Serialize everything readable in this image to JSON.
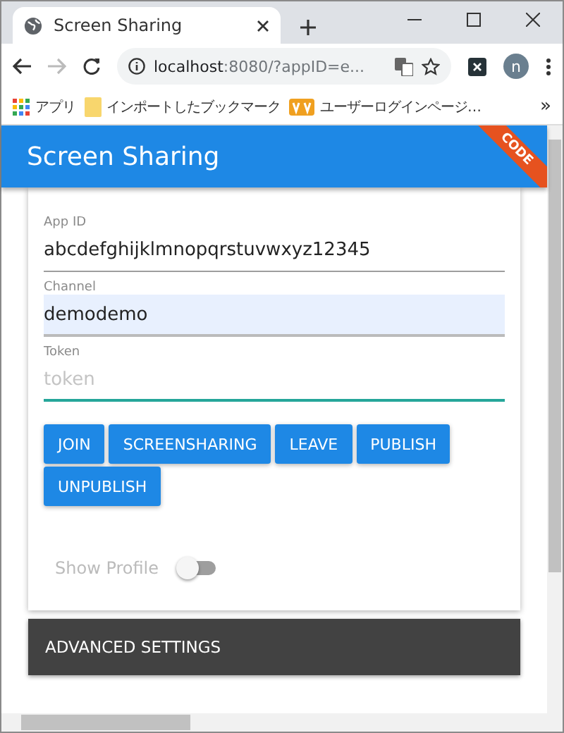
{
  "browser": {
    "tab": {
      "title": "Screen Sharing"
    },
    "address": {
      "host": "localhost",
      "rest": ":8080/?appID=e..."
    },
    "profile_initial": "n",
    "bookmarks": [
      {
        "kind": "apps",
        "label": "アプリ"
      },
      {
        "kind": "folder",
        "label": "インポートしたブックマーク"
      },
      {
        "kind": "page",
        "label": "ユーザーログインページ…"
      }
    ],
    "more": "»"
  },
  "header": {
    "title": "Screen Sharing",
    "ribbon": "CODE"
  },
  "fields": [
    {
      "label": "App ID",
      "value": "abcdefghijklmnopqrstuvwxyz12345",
      "autofilled": false,
      "focused": false
    },
    {
      "label": "Channel",
      "value": "demodemo",
      "autofilled": true,
      "focused": false
    },
    {
      "label": "Token",
      "placeholder": "token",
      "autofilled": false,
      "focused": true
    }
  ],
  "buttons": [
    "JOIN",
    "SCREENSHARING",
    "LEAVE",
    "PUBLISH",
    "UNPUBLISH"
  ],
  "show_profile": {
    "label": "Show Profile",
    "on": false
  },
  "advanced_settings": {
    "label": "ADVANCED SETTINGS",
    "expanded": false
  }
}
